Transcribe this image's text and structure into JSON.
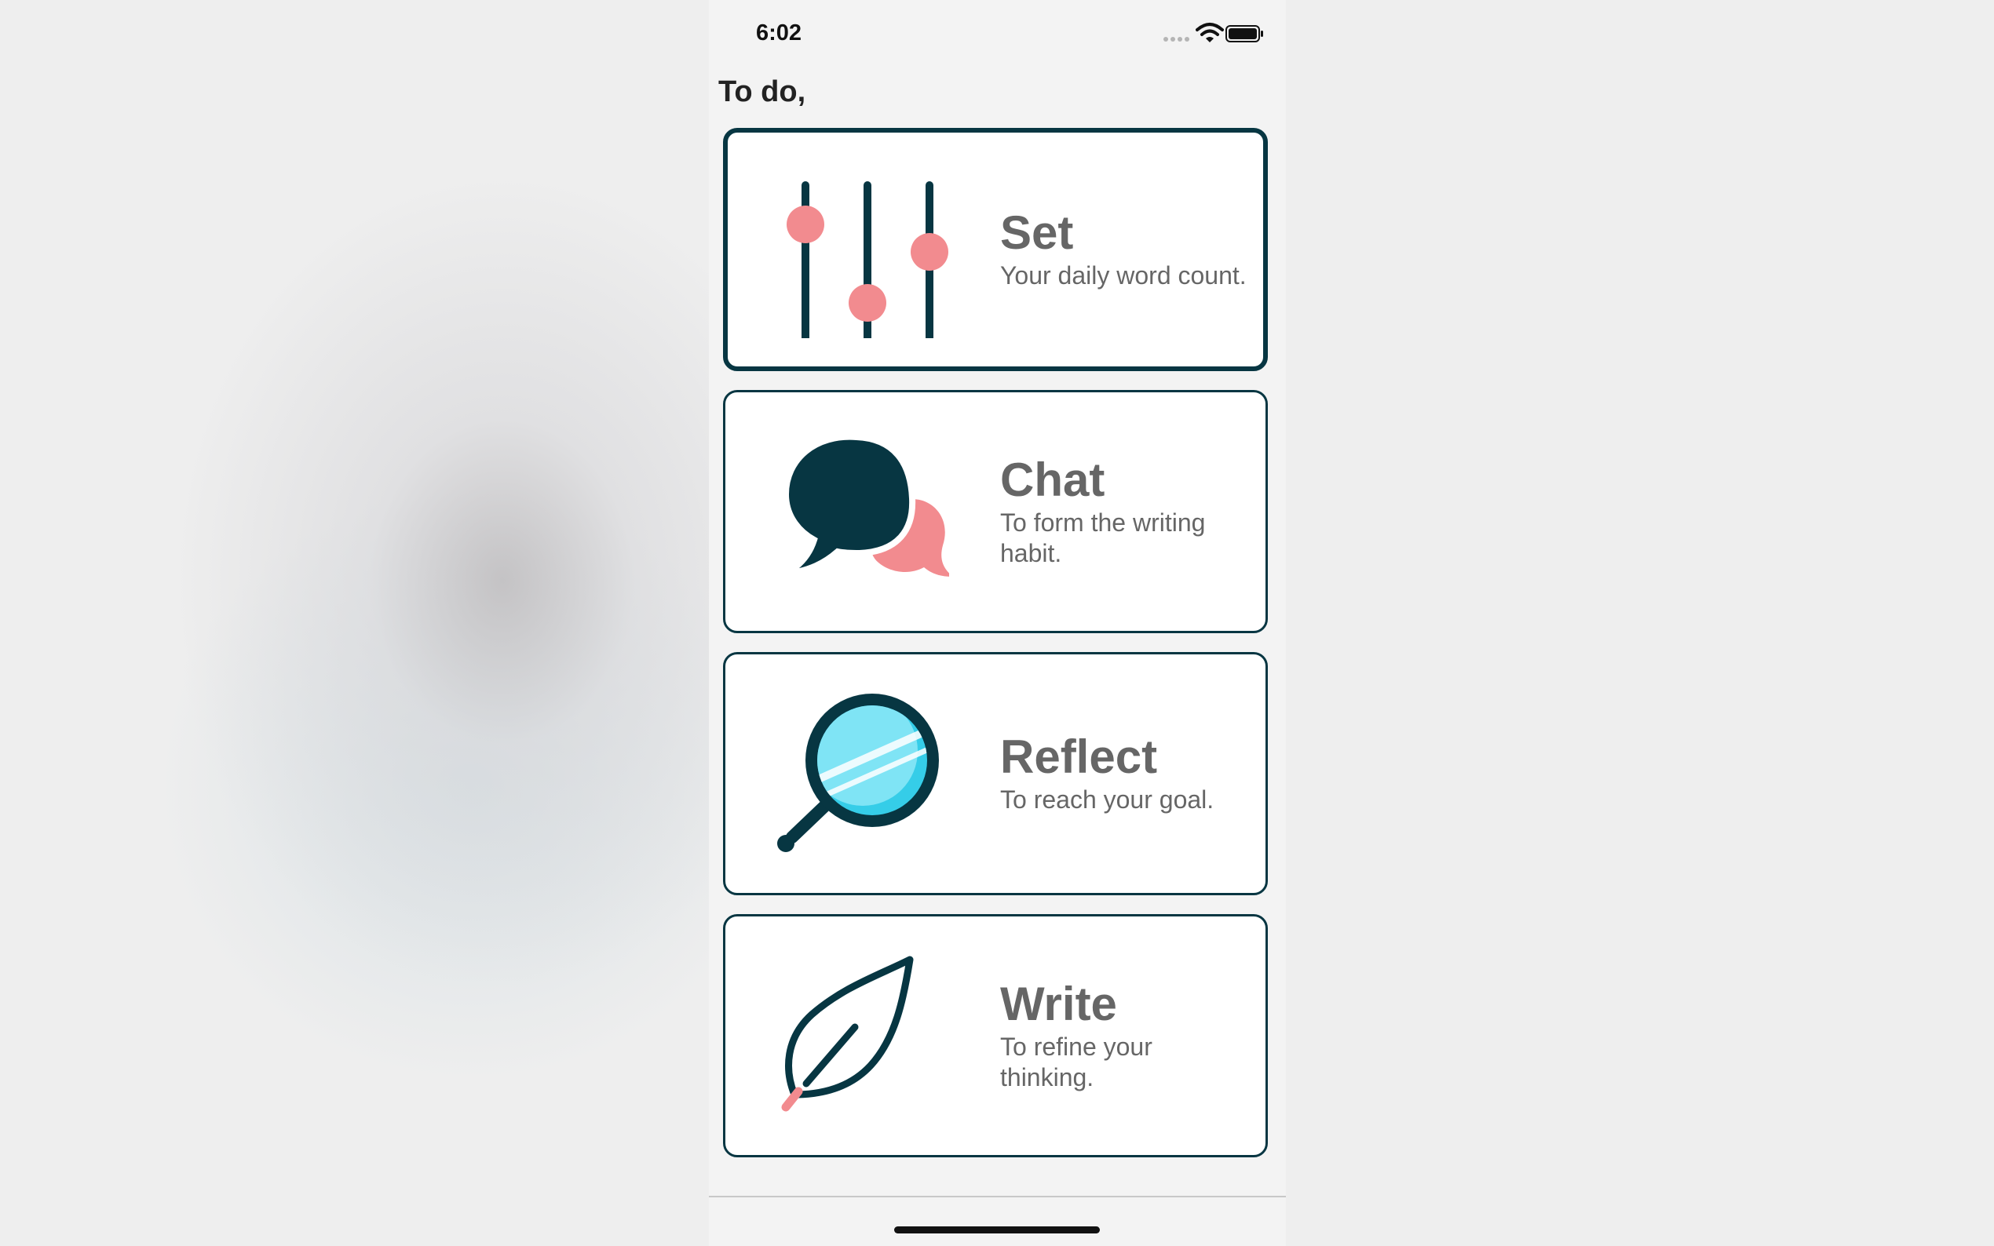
{
  "status_bar": {
    "time": "6:02",
    "signal_icon": "signal-dots-icon",
    "wifi_icon": "wifi-icon",
    "battery_icon": "battery-icon"
  },
  "header": {
    "title": "To do,"
  },
  "cards": [
    {
      "title": "Set",
      "subtitle": "Your daily word count.",
      "icon": "sliders-icon",
      "selected": true
    },
    {
      "title": "Chat",
      "subtitle": "To form the writing habit.",
      "icon": "chat-bubbles-icon",
      "selected": false
    },
    {
      "title": "Reflect",
      "subtitle": "To reach your goal.",
      "icon": "hand-mirror-icon",
      "selected": false
    },
    {
      "title": "Write",
      "subtitle": "To refine your thinking.",
      "icon": "feather-quill-icon",
      "selected": false
    }
  ],
  "colors": {
    "primary": "#073642",
    "accent_pink": "#f28b8f",
    "mirror_cyan": "#6fe0f5",
    "text_gray": "#666666"
  }
}
